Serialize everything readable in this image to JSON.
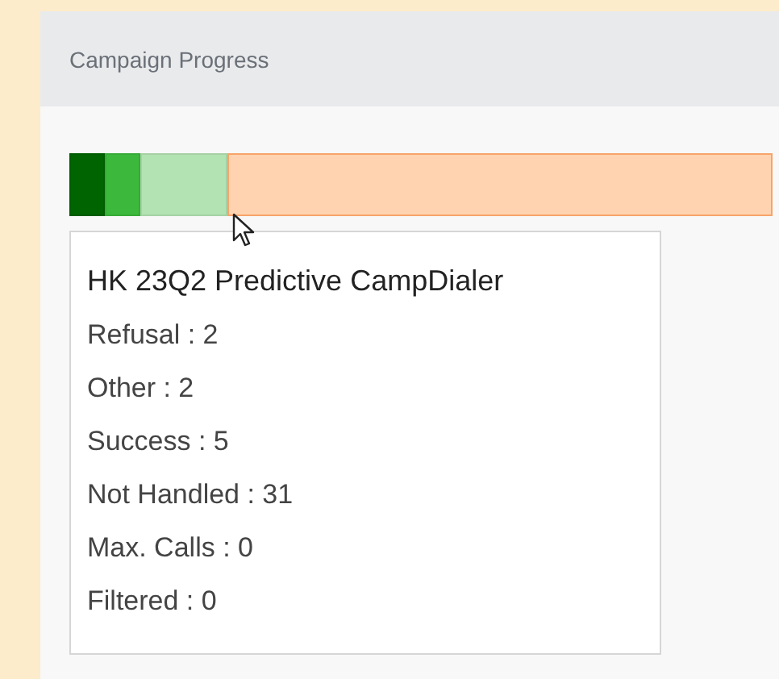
{
  "card": {
    "title": "Campaign Progress"
  },
  "progress": {
    "segments": [
      {
        "level": 0.05,
        "color": "#006400"
      },
      {
        "level": 0.05,
        "color": "#3cb93c"
      },
      {
        "level": 0.125,
        "color": "#b3e3b3"
      },
      {
        "level": 0.775,
        "color": "#ffd3b0"
      }
    ]
  },
  "tooltip": {
    "title": "HK 23Q2 Predictive CampDialer",
    "lines": [
      "Refusal : 2",
      "Other : 2",
      "Success : 5",
      "Not Handled : 31",
      "Max. Calls : 0",
      "Filtered : 0"
    ]
  }
}
